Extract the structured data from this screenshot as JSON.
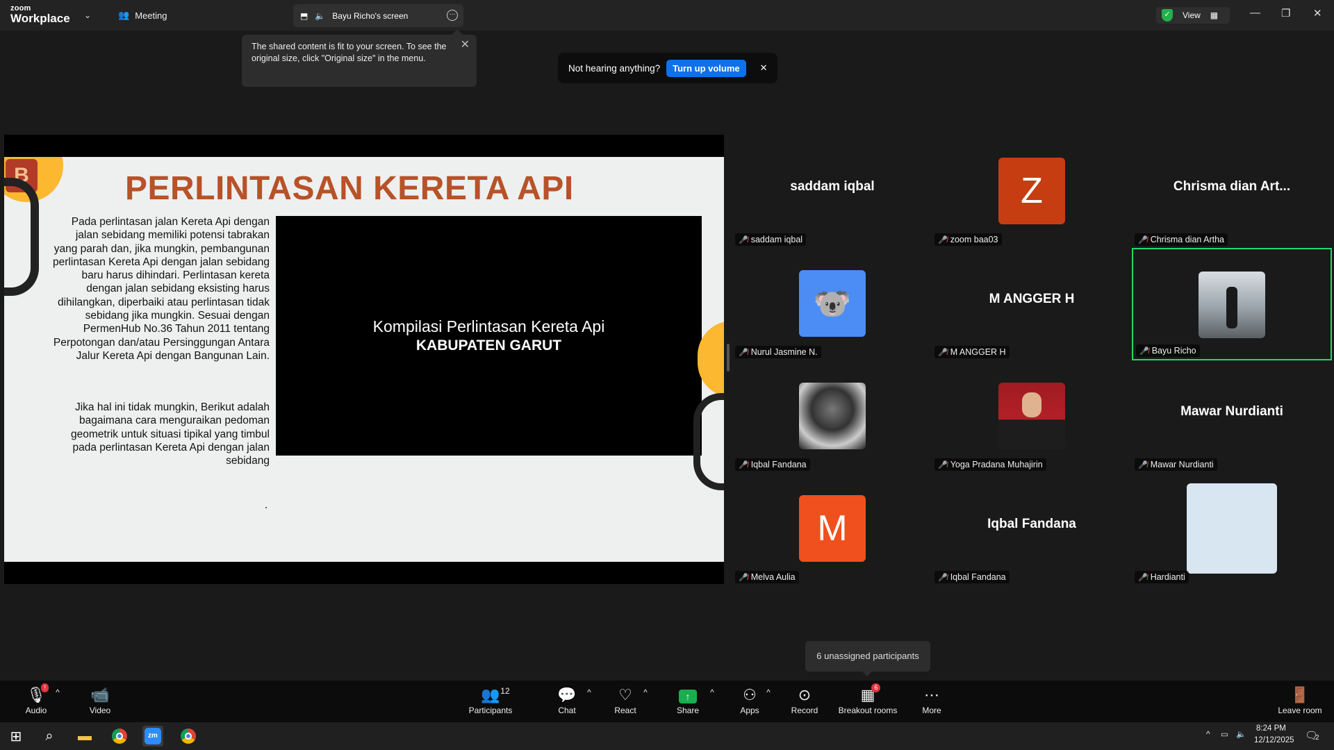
{
  "titlebar": {
    "logo_top": "zoom",
    "logo_bottom": "Workplace",
    "meeting_label": "Meeting",
    "screen_tab_label": "Bayu Richo's screen",
    "view_label": "View"
  },
  "tooltip": {
    "text": "The shared content is fit to your screen. To see the original size, click \"Original size\" in the menu."
  },
  "hearing_banner": {
    "text": "Not hearing anything?",
    "button": "Turn up volume"
  },
  "slide": {
    "title": "PERLINTASAN KERETA API",
    "paragraph1": "Pada perlintasan jalan Kereta Api dengan jalan sebidang memiliki potensi tabrakan yang parah dan, jika mungkin, pembangunan perlintasan Kereta Api dengan jalan sebidang baru harus dihindari. Perlintasan kereta dengan jalan sebidang eksisting harus dihilangkan, diperbaiki atau perlintasan tidak sebidang jika mungkin. Sesuai dengan PermenHub No.36 Tahun 2011 tentang Perpotongan dan/atau Persinggungan Antara Jalur Kereta Api dengan Bangunan Lain.",
    "paragraph2": "Jika hal ini tidak mungkin, Berikut adalah bagaimana cara menguraikan pedoman geometrik untuk situasi tipikal yang timbul pada perlintasan Kereta Api dengan jalan sebidang",
    "video_line1": "Kompilasi Perlintasan Kereta Api",
    "video_line2": "KABUPATEN GARUT",
    "badge_letter": "B"
  },
  "participants": [
    {
      "big_name": "saddam iqbal",
      "label": "saddam iqbal",
      "avatar": "none"
    },
    {
      "big_name": "",
      "label": "zoom baa03",
      "avatar": "letter",
      "letter": "Z",
      "color": "#c63d12"
    },
    {
      "big_name": "Chrisma dian Art...",
      "label": "Chrisma dian Artha",
      "avatar": "none"
    },
    {
      "big_name": "",
      "label": "Nurul Jasmine N.",
      "avatar": "koala"
    },
    {
      "big_name": "M ANGGER H",
      "label": "M ANGGER H",
      "avatar": "none"
    },
    {
      "big_name": "",
      "label": "Bayu Richo",
      "avatar": "photo-bayu",
      "active": true
    },
    {
      "big_name": "",
      "label": "Iqbal Fandana",
      "avatar": "photo-bw"
    },
    {
      "big_name": "",
      "label": "Yoga Pradana Muhajirin",
      "avatar": "photo-red"
    },
    {
      "big_name": "Mawar Nurdianti",
      "label": "Mawar Nurdianti",
      "avatar": "none"
    },
    {
      "big_name": "",
      "label": "Melva Aulia",
      "avatar": "letter",
      "letter": "M",
      "color": "#f0501e"
    },
    {
      "big_name": "Iqbal Fandana",
      "label": "Iqbal Fandana",
      "avatar": "none"
    },
    {
      "big_name": "",
      "label": "Hardianti",
      "avatar": "light"
    }
  ],
  "unassigned_tooltip": "6 unassigned participants",
  "toolbar": {
    "audio": "Audio",
    "video": "Video",
    "participants": "Participants",
    "participants_count": "12",
    "chat": "Chat",
    "react": "React",
    "share": "Share",
    "apps": "Apps",
    "record": "Record",
    "breakout": "Breakout rooms",
    "breakout_badge": "6",
    "more": "More",
    "leave": "Leave room"
  },
  "taskbar": {
    "time": "8:24 PM",
    "date": "12/12/2025",
    "notifications": "2"
  }
}
